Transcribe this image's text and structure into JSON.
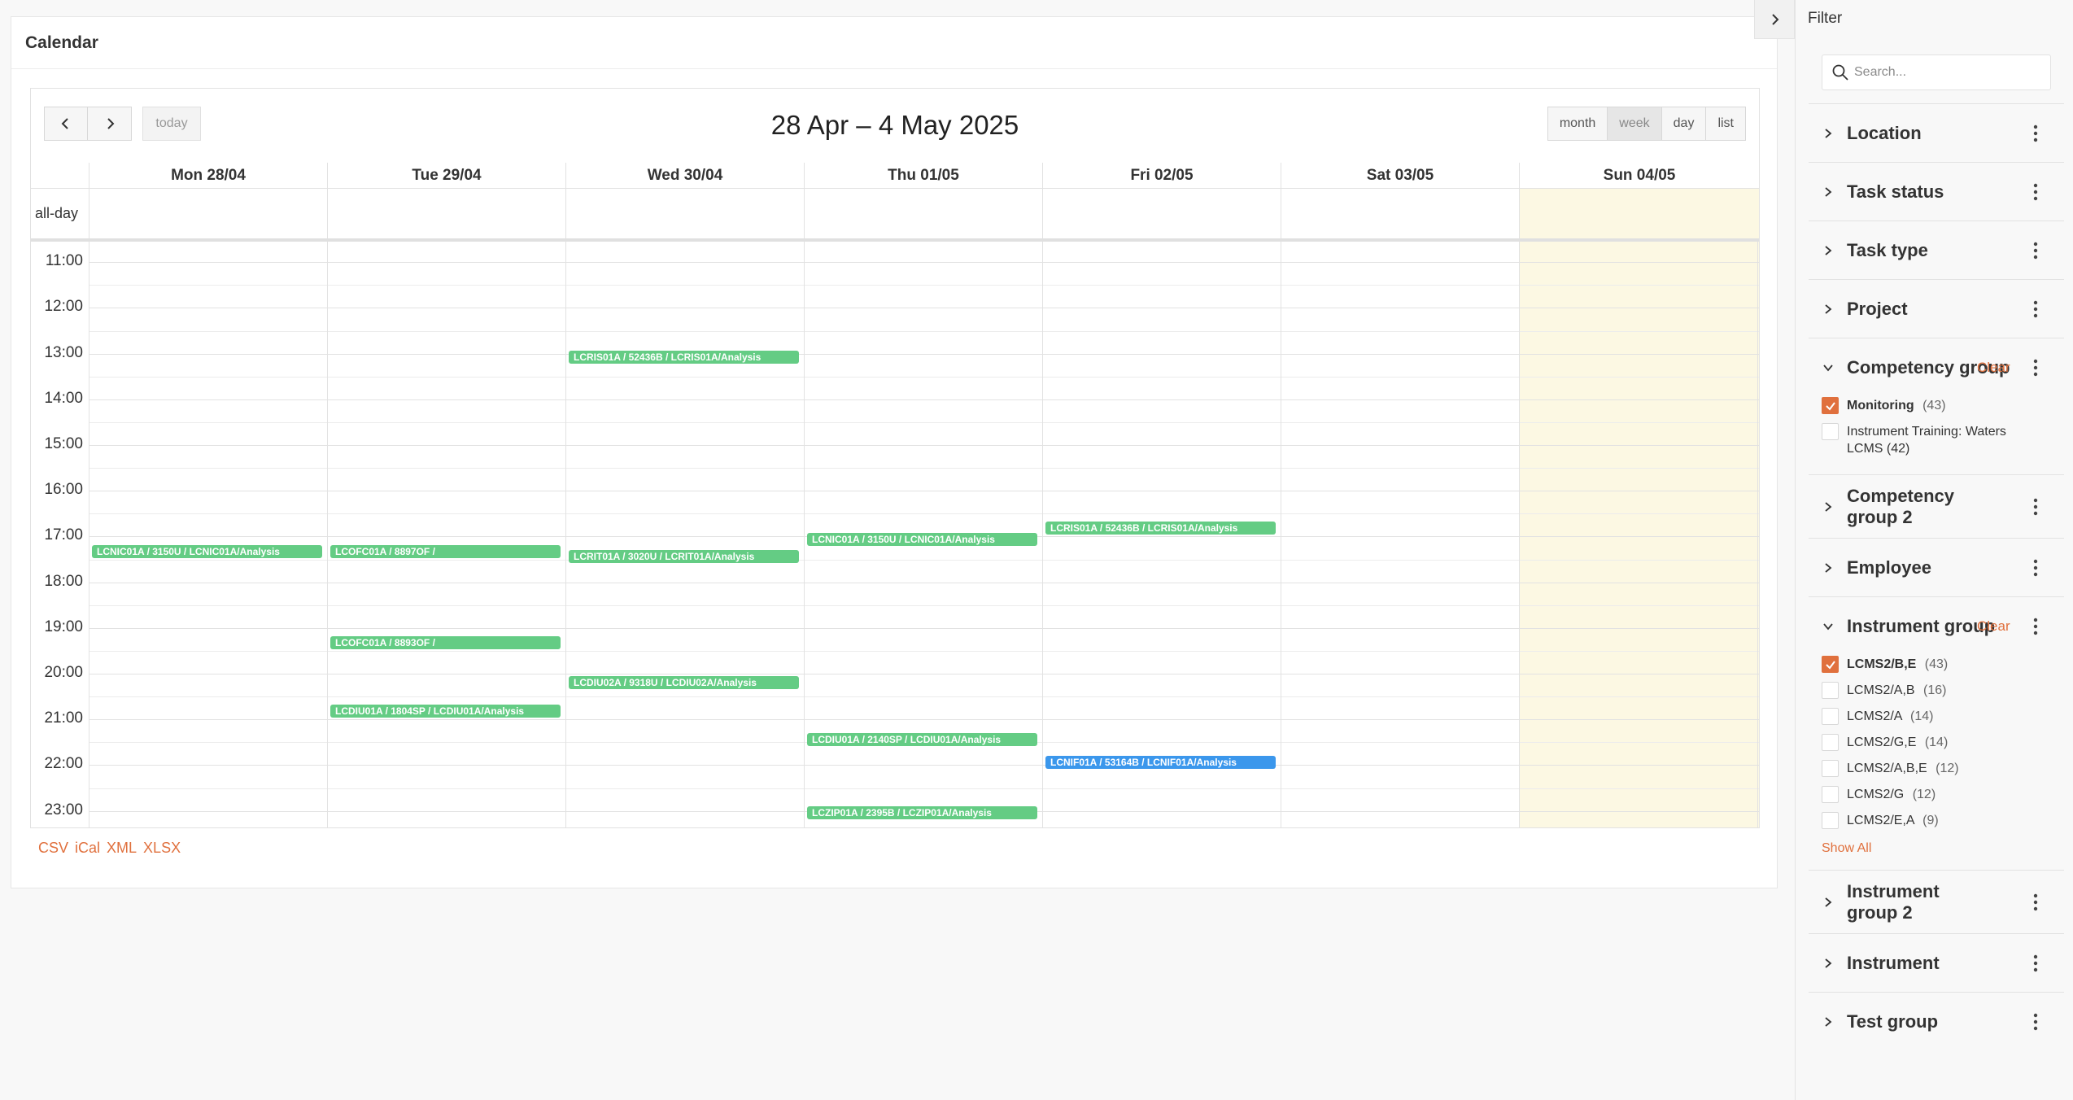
{
  "calendar": {
    "title": "Calendar",
    "range": "28 Apr – 4 May 2025",
    "today_label": "today",
    "views": [
      {
        "label": "month",
        "active": false
      },
      {
        "label": "week",
        "active": true
      },
      {
        "label": "day",
        "active": false
      },
      {
        "label": "list",
        "active": false
      }
    ],
    "allday_label": "all-day",
    "days": [
      "Mon 28/04",
      "Tue 29/04",
      "Wed 30/04",
      "Thu 01/05",
      "Fri 02/05",
      "Sat 03/05",
      "Sun 04/05"
    ],
    "today_index": 6,
    "hours": [
      "11:00",
      "12:00",
      "13:00",
      "14:00",
      "15:00",
      "16:00",
      "17:00",
      "18:00",
      "19:00",
      "20:00",
      "21:00",
      "22:00",
      "23:00"
    ],
    "events": [
      {
        "day": 0,
        "start": "17:15",
        "title": "LCNIC01A / 3150U / LCNIC01A/Analysis",
        "color": "#64cc84"
      },
      {
        "day": 1,
        "start": "17:15",
        "title": "LCOFC01A / 8897OF /",
        "color": "#64cc84"
      },
      {
        "day": 1,
        "start": "19:15",
        "title": "LCOFC01A / 8893OF /",
        "color": "#64cc84"
      },
      {
        "day": 1,
        "start": "20:45",
        "title": "LCDIU01A / 1804SP / LCDIU01A/Analysis",
        "color": "#64cc84"
      },
      {
        "day": 2,
        "start": "13:00",
        "title": "LCRIS01A / 52436B / LCRIS01A/Analysis",
        "color": "#64cc84"
      },
      {
        "day": 2,
        "start": "17:22",
        "title": "LCRIT01A / 3020U / LCRIT01A/Analysis",
        "color": "#64cc84"
      },
      {
        "day": 2,
        "start": "20:07",
        "title": "LCDIU02A / 9318U / LCDIU02A/Analysis",
        "color": "#64cc84"
      },
      {
        "day": 3,
        "start": "17:00",
        "title": "LCNIC01A / 3150U / LCNIC01A/Analysis",
        "color": "#64cc84"
      },
      {
        "day": 3,
        "start": "21:22",
        "title": "LCDIU01A / 2140SP / LCDIU01A/Analysis",
        "color": "#64cc84"
      },
      {
        "day": 3,
        "start": "22:58",
        "title": "LCZIP01A / 2395B / LCZIP01A/Analysis",
        "color": "#64cc84"
      },
      {
        "day": 4,
        "start": "16:45",
        "title": "LCRIS01A / 52436B / LCRIS01A/Analysis",
        "color": "#64cc84"
      },
      {
        "day": 4,
        "start": "21:52",
        "title": "LCNIF01A / 53164B / LCNIF01A/Analysis",
        "color": "#3b97ec"
      }
    ],
    "export_links": [
      "CSV",
      "iCal",
      "XML",
      "XLSX"
    ]
  },
  "filter": {
    "title": "Filter",
    "search_placeholder": "Search...",
    "sections": [
      {
        "title": "Location"
      },
      {
        "title": "Task status"
      },
      {
        "title": "Task type"
      },
      {
        "title": "Project"
      },
      {
        "title": "Competency group",
        "expanded": true,
        "clear_label": "Clear",
        "options": [
          {
            "label": "Monitoring",
            "count": "(43)",
            "checked": true
          },
          {
            "label": "Instrument Training: Waters LCMS",
            "count": "(42)",
            "checked": false
          }
        ]
      },
      {
        "title": "Competency group 2"
      },
      {
        "title": "Employee"
      },
      {
        "title": "Instrument group",
        "expanded": true,
        "clear_label": "Clear",
        "options": [
          {
            "label": "LCMS2/B,E",
            "count": "(43)",
            "checked": true
          },
          {
            "label": "LCMS2/A,B",
            "count": "(16)",
            "checked": false
          },
          {
            "label": "LCMS2/A",
            "count": "(14)",
            "checked": false
          },
          {
            "label": "LCMS2/G,E",
            "count": "(14)",
            "checked": false
          },
          {
            "label": "LCMS2/A,B,E",
            "count": "(12)",
            "checked": false
          },
          {
            "label": "LCMS2/G",
            "count": "(12)",
            "checked": false
          },
          {
            "label": "LCMS2/E,A",
            "count": "(9)",
            "checked": false
          }
        ],
        "show_all_label": "Show All"
      },
      {
        "title": "Instrument group 2"
      },
      {
        "title": "Instrument"
      },
      {
        "title": "Test group"
      }
    ]
  }
}
